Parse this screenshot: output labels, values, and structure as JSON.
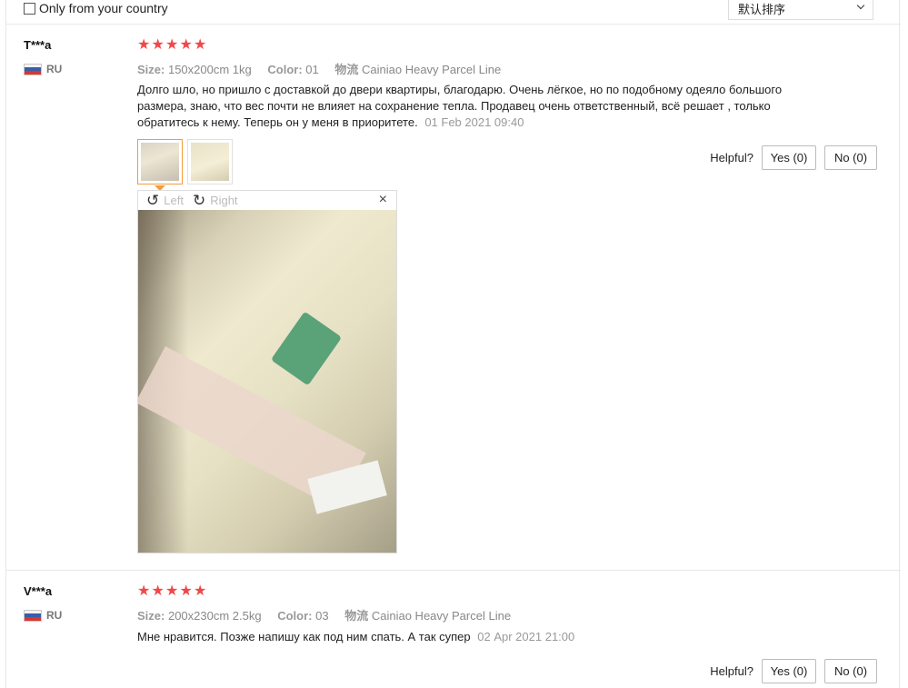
{
  "filter": {
    "country_label": "Only from your country",
    "sort_value": "默认排序"
  },
  "reviews": [
    {
      "author": "T***a",
      "country": "RU",
      "stars": 5,
      "size_label": "Size:",
      "size_value": "150x200cm 1kg",
      "color_label": "Color:",
      "color_value": "01",
      "shipping_label": "物流",
      "shipping_value": "Cainiao Heavy Parcel Line",
      "text": "Долго шло, но пришло с доставкой до двери квартиры, благодарю. Очень лёгкое, но по подобному одеяло большого размера, знаю, что вес почти не влияет на сохранение тепла. Продавец очень ответственный, всё решает , только обратитесь к нему. Теперь он у меня в приоритете.",
      "date": "01 Feb 2021 09:40",
      "helpful_label": "Helpful?",
      "yes_label": "Yes (0)",
      "no_label": "No (0)",
      "viewer": {
        "left_label": "Left",
        "right_label": "Right",
        "close_symbol": "×"
      }
    },
    {
      "author": "V***a",
      "country": "RU",
      "stars": 5,
      "size_label": "Size:",
      "size_value": "200x230cm 2.5kg",
      "color_label": "Color:",
      "color_value": "03",
      "shipping_label": "物流",
      "shipping_value": "Cainiao Heavy Parcel Line",
      "text": "Мне нравится. Позже напишу как под ним спать. А так супер",
      "date": "02 Apr 2021 21:00",
      "helpful_label": "Helpful?",
      "yes_label": "Yes (0)",
      "no_label": "No (0)"
    }
  ],
  "icons": {
    "star": "★",
    "rotate_left": "↺",
    "rotate_right": "↻"
  },
  "colors": {
    "star": "#f0484a",
    "thumb_active_border": "#f59c38",
    "muted_text": "#999999"
  }
}
